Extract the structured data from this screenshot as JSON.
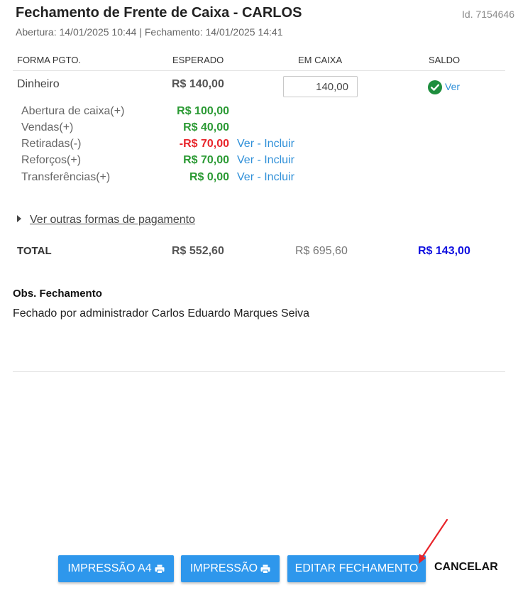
{
  "header": {
    "title": "Fechamento de Frente de Caixa - CARLOS",
    "id": "Id. 7154646",
    "subtitle": "Abertura: 14/01/2025 10:44 | Fechamento: 14/01/2025 14:41"
  },
  "table": {
    "columns": [
      "FORMA PGTO.",
      "ESPERADO",
      "EM CAIXA",
      "SALDO"
    ]
  },
  "payment": {
    "name": "Dinheiro",
    "expected": "R$ 140,00",
    "in_cash": "140,00",
    "view_label": "Ver",
    "details": [
      {
        "label": "Abertura de caixa(+)",
        "value": "R$ 100,00"
      },
      {
        "label": "Vendas(+)",
        "value": "R$ 40,00"
      },
      {
        "label": "Retiradas(-)",
        "value": "-R$ 70,00",
        "view": "Ver",
        "sep": " - ",
        "include": "Incluir"
      },
      {
        "label": "Reforços(+)",
        "value": "R$ 70,00",
        "view": "Ver",
        "sep": " - ",
        "include": "Incluir"
      },
      {
        "label": "Transferências(+)",
        "value": "R$ 0,00",
        "view": "Ver",
        "sep": " - ",
        "include": "Incluir"
      }
    ]
  },
  "other_payments_label": "Ver outras formas de pagamento",
  "total": {
    "label": "TOTAL",
    "expected": "R$ 552,60",
    "in_cash": "R$ 695,60",
    "balance": "R$ 143,00"
  },
  "obs": {
    "title": "Obs. Fechamento",
    "text": "Fechado por administrador Carlos Eduardo Marques Seiva"
  },
  "buttons": {
    "print_a4": "IMPRESSÃO A4",
    "print": "IMPRESSÃO",
    "edit_closing": "EDITAR FECHAMENTO",
    "cancel": "CANCELAR"
  },
  "colors": {
    "primary_button": "#2e97ec",
    "link": "#2e8fd8",
    "positive": "#2b9a34",
    "negative": "#e8242a",
    "balance": "#1010e0",
    "ok_icon": "#1e8e3e",
    "annotation_arrow": "#e8242a"
  },
  "icons": {
    "ok": "check-circle-icon",
    "printer": "printer-icon",
    "expand": "caret-right-icon"
  }
}
